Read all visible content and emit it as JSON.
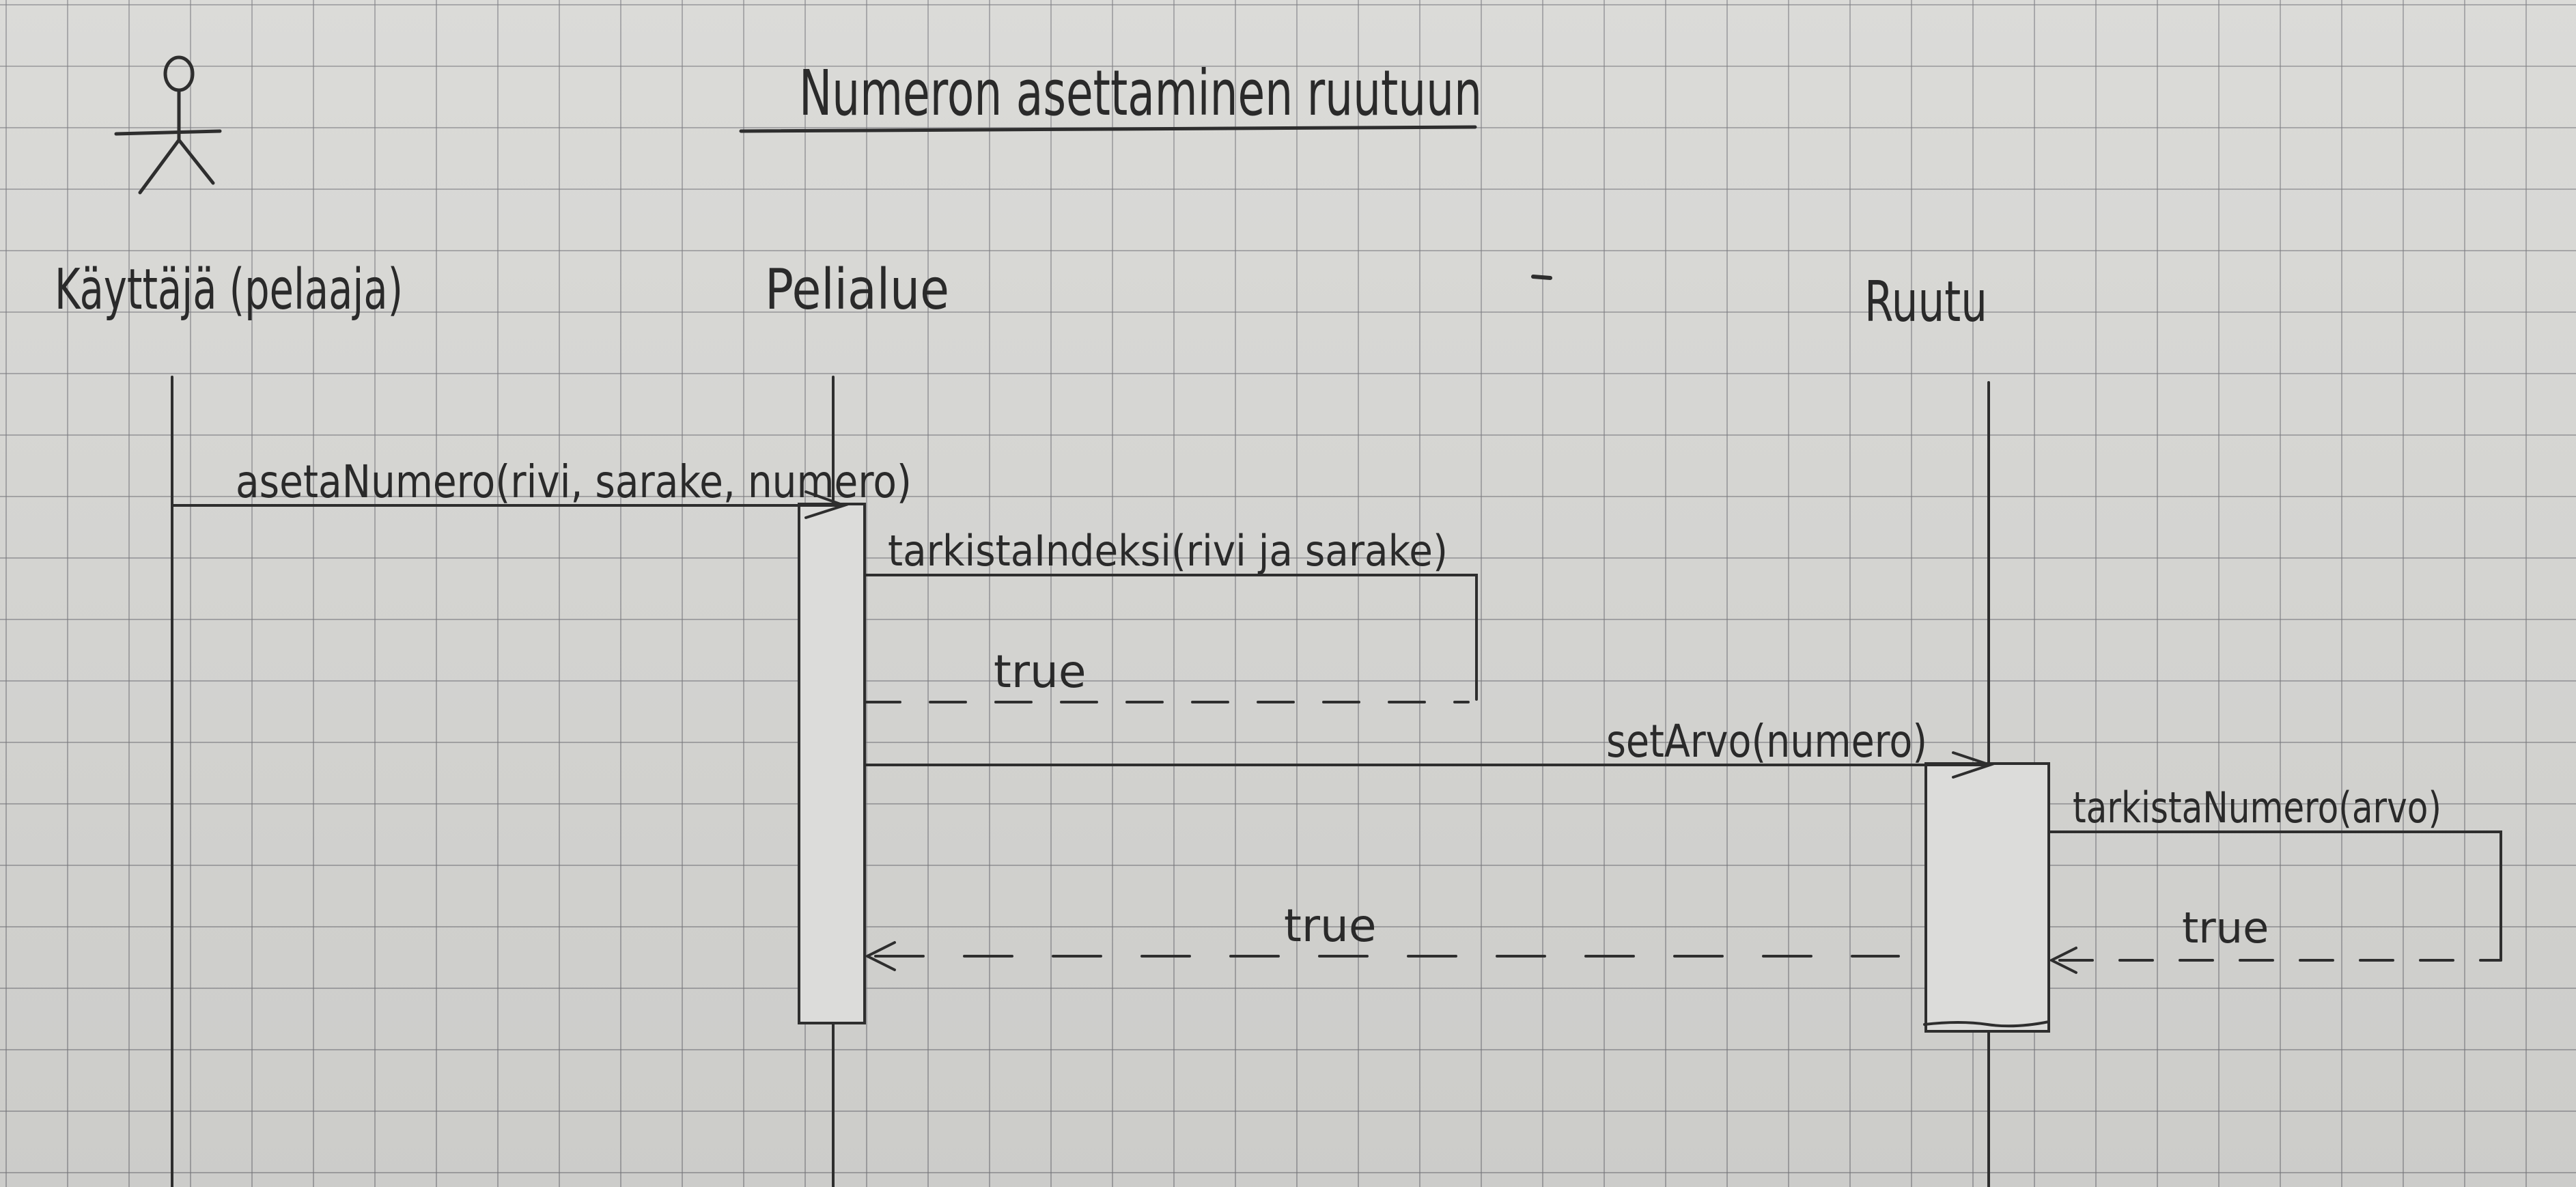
{
  "diagram": {
    "title": "Numeron asettaminen ruutuun",
    "participants": [
      {
        "id": "user",
        "label": "Käyttäjä (pelaaja)",
        "is_actor": true
      },
      {
        "id": "pelialue",
        "label": "Pelialue"
      },
      {
        "id": "ruutu",
        "label": "Ruutu"
      }
    ],
    "messages": [
      {
        "id": "m1",
        "from": "user",
        "to": "pelialue",
        "label": "asetaNumero(rivi, sarake, numero)",
        "kind": "call"
      },
      {
        "id": "m2",
        "from": "pelialue",
        "to": "pelialue",
        "label": "tarkistaIndeksi(rivi ja sarake)",
        "kind": "self-call"
      },
      {
        "id": "m3",
        "from": "pelialue",
        "to": "pelialue",
        "label": "true",
        "kind": "return"
      },
      {
        "id": "m4",
        "from": "pelialue",
        "to": "ruutu",
        "label": "setArvo(numero)",
        "kind": "call"
      },
      {
        "id": "m5",
        "from": "ruutu",
        "to": "ruutu",
        "label": "tarkistaNumero(arvo)",
        "kind": "self-call"
      },
      {
        "id": "m6",
        "from": "ruutu",
        "to": "ruutu",
        "label": "true",
        "kind": "return"
      },
      {
        "id": "m7",
        "from": "ruutu",
        "to": "pelialue",
        "label": "true",
        "kind": "return"
      }
    ]
  }
}
